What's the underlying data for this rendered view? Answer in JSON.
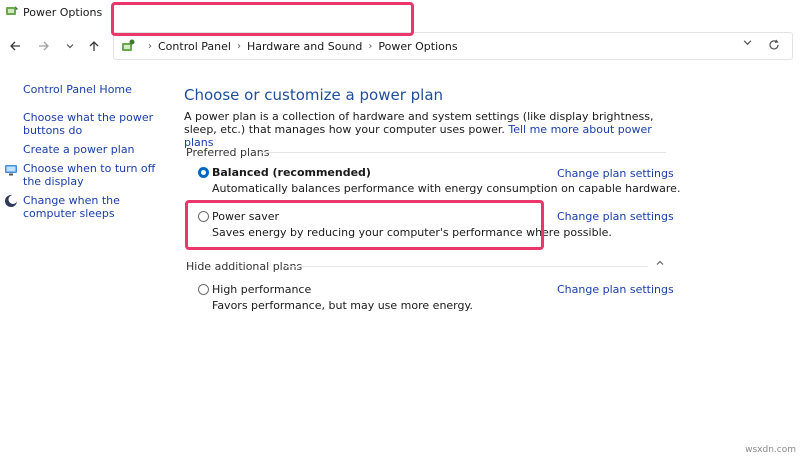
{
  "window": {
    "title": "Power Options"
  },
  "nav": {
    "back_icon": "arrow-left-icon",
    "forward_icon": "arrow-right-icon",
    "recent_icon": "chevron-down-icon",
    "up_icon": "arrow-up-icon"
  },
  "address": {
    "breadcrumbs": [
      "Control Panel",
      "Hardware and Sound",
      "Power Options"
    ],
    "separator": "›",
    "dropdown_icon": "chevron-down-icon",
    "refresh_icon": "refresh-icon"
  },
  "sidebar": {
    "home": "Control Panel Home",
    "links": [
      {
        "label": "Choose what the power buttons do",
        "icon": ""
      },
      {
        "label": "Create a power plan",
        "icon": ""
      },
      {
        "label": "Choose when to turn off the display",
        "icon": "monitor-icon"
      },
      {
        "label": "Change when the computer sleeps",
        "icon": "moon-icon"
      }
    ]
  },
  "main": {
    "title": "Choose or customize a power plan",
    "intro": "A power plan is a collection of hardware and system settings (like display brightness, sleep, etc.) that manages how your computer uses power.",
    "intro_link": "Tell me more about power plans",
    "preferred_label": "Preferred plans",
    "hide_label": "Hide additional plans",
    "change_label": "Change plan settings",
    "plans": [
      {
        "name": "Balanced (recommended)",
        "desc": "Automatically balances performance with energy consumption on capable hardware.",
        "selected": true
      },
      {
        "name": "Power saver",
        "desc": "Saves energy by reducing your computer's performance where possible.",
        "selected": false
      },
      {
        "name": "High performance",
        "desc": "Favors performance, but may use more energy.",
        "selected": false
      }
    ]
  },
  "colors": {
    "accent": "#0067c0",
    "link": "#1a3ea8",
    "title": "#1e4f9c",
    "highlight": "#e9366b"
  },
  "watermark": "wsxdn.com"
}
